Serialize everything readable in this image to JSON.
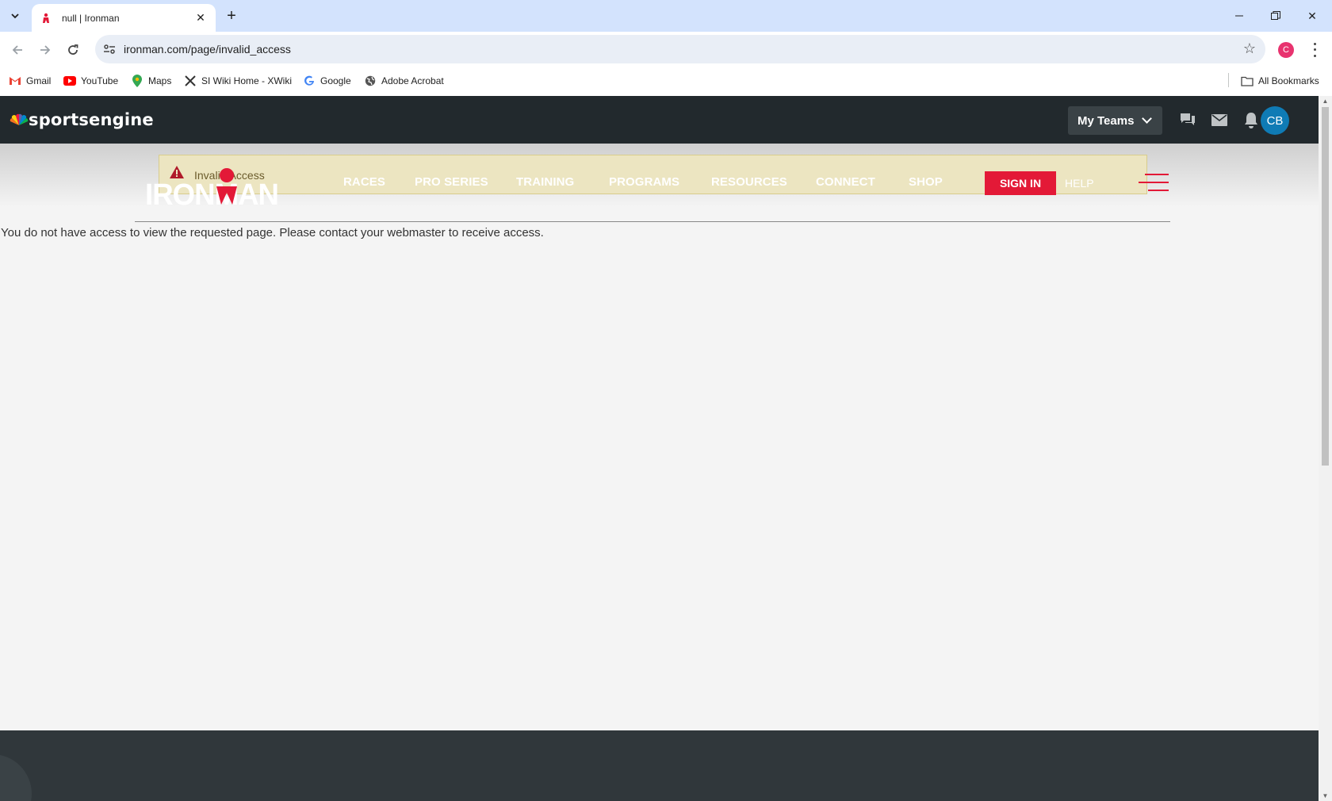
{
  "browser": {
    "tab_title": "null | Ironman",
    "url": "ironman.com/page/invalid_access",
    "profile_initial": "C",
    "bookmarks": [
      {
        "label": "Gmail",
        "icon": "gmail-icon"
      },
      {
        "label": "YouTube",
        "icon": "youtube-icon"
      },
      {
        "label": "Maps",
        "icon": "maps-icon"
      },
      {
        "label": "SI Wiki Home - XWiki",
        "icon": "xwiki-icon"
      },
      {
        "label": "Google",
        "icon": "google-icon"
      },
      {
        "label": "Adobe Acrobat",
        "icon": "globe-icon"
      }
    ],
    "all_bookmarks": "All Bookmarks"
  },
  "se_bar": {
    "logo_text": "sportsengine",
    "my_teams": "My Teams",
    "avatar_initials": "CB"
  },
  "alert": {
    "text": "Invalid Access"
  },
  "nav": {
    "items": [
      "RACES",
      "PRO SERIES",
      "TRAINING",
      "PROGRAMS",
      "RESOURCES",
      "CONNECT",
      "SHOP"
    ],
    "sign_in": "SIGN IN",
    "help": "HELP"
  },
  "logo": {
    "text": "IRONMAN"
  },
  "main": {
    "message": "You do not have access to view the requested page. Please contact your webmaster to receive access."
  },
  "colors": {
    "accent_red": "#e31937",
    "se_dark": "#22292d",
    "avatar_blue": "#0f7bb5",
    "alert_bg": "#ece5c1"
  }
}
